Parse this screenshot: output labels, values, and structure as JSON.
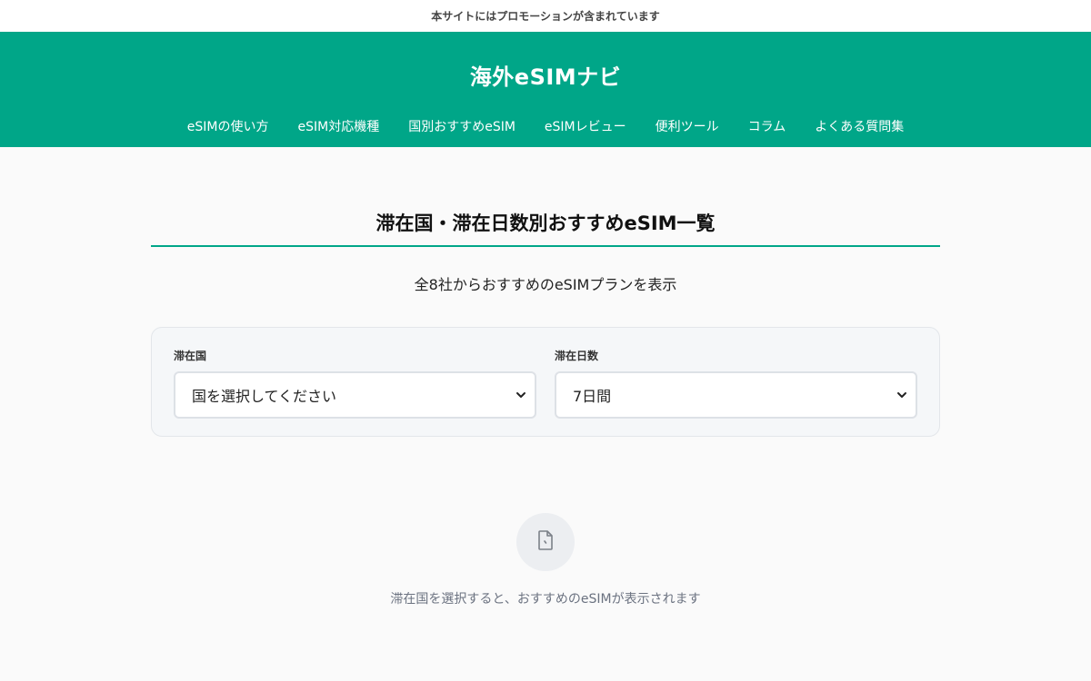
{
  "promo_notice": "本サイトにはプロモーションが含まれています",
  "header": {
    "site_title": "海外eSIMナビ",
    "nav": [
      {
        "label": "eSIMの使い方"
      },
      {
        "label": "eSIM対応機種"
      },
      {
        "label": "国別おすすめeSIM"
      },
      {
        "label": "eSIMレビュー"
      },
      {
        "label": "便利ツール"
      },
      {
        "label": "コラム"
      },
      {
        "label": "よくある質問集"
      }
    ]
  },
  "main": {
    "title": "滞在国・滞在日数別おすすめeSIM一覧",
    "subtitle": "全8社からおすすめのeSIMプランを表示",
    "filters": {
      "country": {
        "label": "滞在国",
        "selected": "国を選択してください",
        "icon": "chevron-down-icon"
      },
      "days": {
        "label": "滞在日数",
        "selected": "7日間",
        "icon": "chevron-down-icon"
      }
    },
    "empty_state": {
      "icon": "document-icon",
      "message": "滞在国を選択すると、おすすめのeSIMが表示されます"
    }
  },
  "colors": {
    "accent": "#00a688",
    "page_background": "#fafafa",
    "card_background": "#f5f7f9",
    "muted_text": "#6b7280"
  }
}
